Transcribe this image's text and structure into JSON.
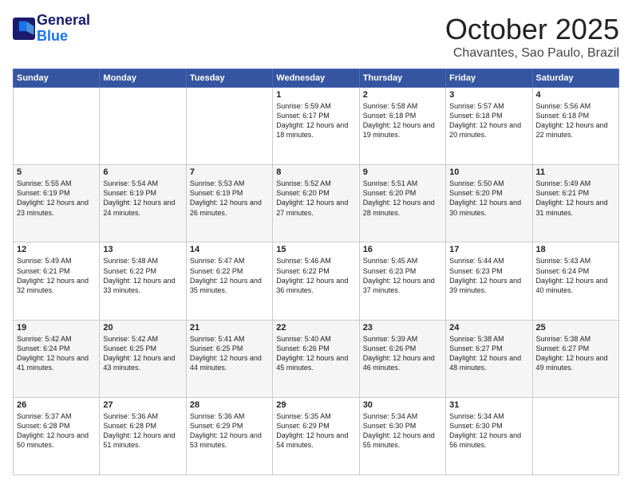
{
  "logo": {
    "line1": "General",
    "line2": "Blue"
  },
  "title": "October 2025",
  "subtitle": "Chavantes, Sao Paulo, Brazil",
  "days_header": [
    "Sunday",
    "Monday",
    "Tuesday",
    "Wednesday",
    "Thursday",
    "Friday",
    "Saturday"
  ],
  "weeks": [
    [
      {
        "day": "",
        "text": ""
      },
      {
        "day": "",
        "text": ""
      },
      {
        "day": "",
        "text": ""
      },
      {
        "day": "1",
        "text": "Sunrise: 5:59 AM\nSunset: 6:17 PM\nDaylight: 12 hours\nand 18 minutes."
      },
      {
        "day": "2",
        "text": "Sunrise: 5:58 AM\nSunset: 6:18 PM\nDaylight: 12 hours\nand 19 minutes."
      },
      {
        "day": "3",
        "text": "Sunrise: 5:57 AM\nSunset: 6:18 PM\nDaylight: 12 hours\nand 20 minutes."
      },
      {
        "day": "4",
        "text": "Sunrise: 5:56 AM\nSunset: 6:18 PM\nDaylight: 12 hours\nand 22 minutes."
      }
    ],
    [
      {
        "day": "5",
        "text": "Sunrise: 5:55 AM\nSunset: 6:19 PM\nDaylight: 12 hours\nand 23 minutes."
      },
      {
        "day": "6",
        "text": "Sunrise: 5:54 AM\nSunset: 6:19 PM\nDaylight: 12 hours\nand 24 minutes."
      },
      {
        "day": "7",
        "text": "Sunrise: 5:53 AM\nSunset: 6:19 PM\nDaylight: 12 hours\nand 26 minutes."
      },
      {
        "day": "8",
        "text": "Sunrise: 5:52 AM\nSunset: 6:20 PM\nDaylight: 12 hours\nand 27 minutes."
      },
      {
        "day": "9",
        "text": "Sunrise: 5:51 AM\nSunset: 6:20 PM\nDaylight: 12 hours\nand 28 minutes."
      },
      {
        "day": "10",
        "text": "Sunrise: 5:50 AM\nSunset: 6:20 PM\nDaylight: 12 hours\nand 30 minutes."
      },
      {
        "day": "11",
        "text": "Sunrise: 5:49 AM\nSunset: 6:21 PM\nDaylight: 12 hours\nand 31 minutes."
      }
    ],
    [
      {
        "day": "12",
        "text": "Sunrise: 5:49 AM\nSunset: 6:21 PM\nDaylight: 12 hours\nand 32 minutes."
      },
      {
        "day": "13",
        "text": "Sunrise: 5:48 AM\nSunset: 6:22 PM\nDaylight: 12 hours\nand 33 minutes."
      },
      {
        "day": "14",
        "text": "Sunrise: 5:47 AM\nSunset: 6:22 PM\nDaylight: 12 hours\nand 35 minutes."
      },
      {
        "day": "15",
        "text": "Sunrise: 5:46 AM\nSunset: 6:22 PM\nDaylight: 12 hours\nand 36 minutes."
      },
      {
        "day": "16",
        "text": "Sunrise: 5:45 AM\nSunset: 6:23 PM\nDaylight: 12 hours\nand 37 minutes."
      },
      {
        "day": "17",
        "text": "Sunrise: 5:44 AM\nSunset: 6:23 PM\nDaylight: 12 hours\nand 39 minutes."
      },
      {
        "day": "18",
        "text": "Sunrise: 5:43 AM\nSunset: 6:24 PM\nDaylight: 12 hours\nand 40 minutes."
      }
    ],
    [
      {
        "day": "19",
        "text": "Sunrise: 5:42 AM\nSunset: 6:24 PM\nDaylight: 12 hours\nand 41 minutes."
      },
      {
        "day": "20",
        "text": "Sunrise: 5:42 AM\nSunset: 6:25 PM\nDaylight: 12 hours\nand 43 minutes."
      },
      {
        "day": "21",
        "text": "Sunrise: 5:41 AM\nSunset: 6:25 PM\nDaylight: 12 hours\nand 44 minutes."
      },
      {
        "day": "22",
        "text": "Sunrise: 5:40 AM\nSunset: 6:26 PM\nDaylight: 12 hours\nand 45 minutes."
      },
      {
        "day": "23",
        "text": "Sunrise: 5:39 AM\nSunset: 6:26 PM\nDaylight: 12 hours\nand 46 minutes."
      },
      {
        "day": "24",
        "text": "Sunrise: 5:38 AM\nSunset: 6:27 PM\nDaylight: 12 hours\nand 48 minutes."
      },
      {
        "day": "25",
        "text": "Sunrise: 5:38 AM\nSunset: 6:27 PM\nDaylight: 12 hours\nand 49 minutes."
      }
    ],
    [
      {
        "day": "26",
        "text": "Sunrise: 5:37 AM\nSunset: 6:28 PM\nDaylight: 12 hours\nand 50 minutes."
      },
      {
        "day": "27",
        "text": "Sunrise: 5:36 AM\nSunset: 6:28 PM\nDaylight: 12 hours\nand 51 minutes."
      },
      {
        "day": "28",
        "text": "Sunrise: 5:36 AM\nSunset: 6:29 PM\nDaylight: 12 hours\nand 53 minutes."
      },
      {
        "day": "29",
        "text": "Sunrise: 5:35 AM\nSunset: 6:29 PM\nDaylight: 12 hours\nand 54 minutes."
      },
      {
        "day": "30",
        "text": "Sunrise: 5:34 AM\nSunset: 6:30 PM\nDaylight: 12 hours\nand 55 minutes."
      },
      {
        "day": "31",
        "text": "Sunrise: 5:34 AM\nSunset: 6:30 PM\nDaylight: 12 hours\nand 56 minutes."
      },
      {
        "day": "",
        "text": ""
      }
    ]
  ]
}
